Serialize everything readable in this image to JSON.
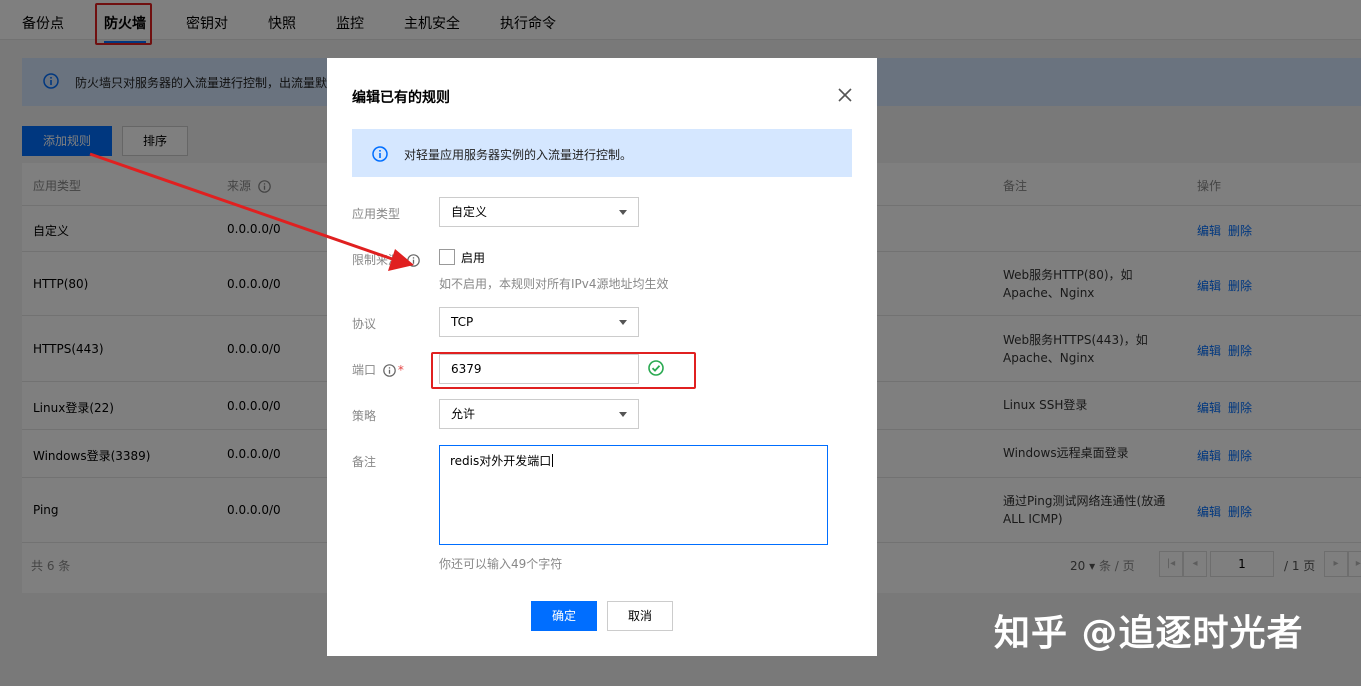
{
  "tabs": [
    "备份点",
    "防火墙",
    "密钥对",
    "快照",
    "监控",
    "主机安全",
    "执行命令"
  ],
  "page_notice": "防火墙只对服务器的入流量进行控制，出流量默",
  "toolbar": {
    "add_rule": "添加规则",
    "sort": "排序"
  },
  "table": {
    "headers": {
      "app_type": "应用类型",
      "source": "来源",
      "note": "备注",
      "actions": "操作"
    },
    "rows": [
      {
        "app": "自定义",
        "source": "0.0.0.0/0",
        "note": "",
        "edit": "编辑",
        "delete": "删除"
      },
      {
        "app": "HTTP(80)",
        "source": "0.0.0.0/0",
        "note": "Web服务HTTP(80)，如Apache、Nginx",
        "edit": "编辑",
        "delete": "删除"
      },
      {
        "app": "HTTPS(443)",
        "source": "0.0.0.0/0",
        "note": "Web服务HTTPS(443)，如Apache、Nginx",
        "edit": "编辑",
        "delete": "删除"
      },
      {
        "app": "Linux登录(22)",
        "source": "0.0.0.0/0",
        "note": "Linux SSH登录",
        "edit": "编辑",
        "delete": "删除"
      },
      {
        "app": "Windows登录(3389)",
        "source": "0.0.0.0/0",
        "note": "Windows远程桌面登录",
        "edit": "编辑",
        "delete": "删除"
      },
      {
        "app": "Ping",
        "source": "0.0.0.0/0",
        "note": "通过Ping测试网络连通性(放通ALL ICMP)",
        "edit": "编辑",
        "delete": "删除"
      }
    ],
    "footer": {
      "total": "共 6 条",
      "page_size": "20",
      "page_size_unit": "条 / 页",
      "current_page": "1",
      "total_pages": "/ 1 页"
    }
  },
  "dialog": {
    "title": "编辑已有的规则",
    "notice": "对轻量应用服务器实例的入流量进行控制。",
    "fields": {
      "app_type_label": "应用类型",
      "app_type_value": "自定义",
      "limit_label": "限制来源",
      "limit_checkbox_label": "启用",
      "limit_hint": "如不启用，本规则对所有IPv4源地址均生效",
      "protocol_label": "协议",
      "protocol_value": "TCP",
      "port_label": "端口",
      "port_required": "*",
      "port_value": "6379",
      "policy_label": "策略",
      "policy_value": "允许",
      "note_label": "备注",
      "note_value": "redis对外开发端口",
      "note_hint": "你还可以输入49个字符"
    },
    "ok": "确定",
    "cancel": "取消"
  },
  "watermark": "知乎 @追逐时光者",
  "colors": {
    "primary": "#006eff",
    "annotation_red": "#e02020",
    "success_green": "#29a950",
    "notice_bg": "#d5e7ff"
  }
}
